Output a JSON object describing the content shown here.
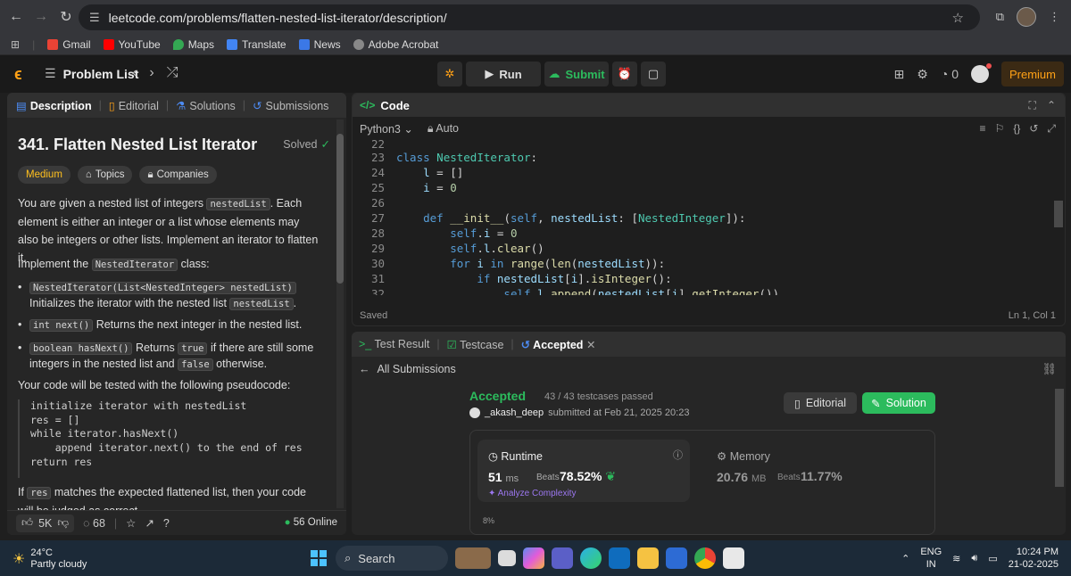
{
  "browser": {
    "url": "leetcode.com/problems/flatten-nested-list-iterator/description/",
    "bookmarks": [
      "Gmail",
      "YouTube",
      "Maps",
      "Translate",
      "News",
      "Adobe Acrobat"
    ]
  },
  "nav": {
    "problem_list": "Problem List",
    "run": "Run",
    "submit": "Submit",
    "streak_count": "0",
    "premium": "Premium"
  },
  "left": {
    "tabs": [
      "Description",
      "Editorial",
      "Solutions",
      "Submissions"
    ],
    "title": "341. Flatten Nested List Iterator",
    "solved": "Solved",
    "badges": [
      "Medium",
      "Topics",
      "Companies"
    ],
    "p1_a": "You are given a nested list of integers ",
    "p1_code": "nestedList",
    "p1_b": ". Each element is either an integer or a list whose elements may also be integers or other lists. Implement an iterator to flatten it.",
    "p2_a": "Implement the ",
    "p2_code": "NestedIterator",
    "p2_b": " class:",
    "b1_code": "NestedIterator(List<NestedInteger> nestedList)",
    "b1_a": " Initializes the iterator with the nested list ",
    "b1_code2": "nestedList",
    "b1_b": ".",
    "b2_code": "int next()",
    "b2_a": " Returns the next integer in the nested list.",
    "b3_code": "boolean hasNext()",
    "b3_a": " Returns ",
    "b3_code2": "true",
    "b3_b": " if there are still some integers in the nested list and ",
    "b3_code3": "false",
    "b3_c": " otherwise.",
    "p3": "Your code will be tested with the following pseudocode:",
    "pseudocode": "initialize iterator with nestedList\nres = []\nwhile iterator.hasNext()\n    append iterator.next() to the end of res\nreturn res",
    "p4_a": "If ",
    "p4_code": "res",
    "p4_b": " matches the expected flattened list, then your code will be judged as correct.",
    "likes": "5K",
    "comments": "68",
    "online": "56 Online"
  },
  "code": {
    "header": "Code",
    "language": "Python3",
    "mode": "Auto",
    "status": "Saved",
    "cursor": "Ln 1, Col 1",
    "line_numbers": [
      "22",
      "23",
      "24",
      "25",
      "26",
      "27",
      "28",
      "29",
      "30",
      "31",
      "32"
    ]
  },
  "result": {
    "tabs": [
      "Test Result",
      "Testcase",
      "Accepted"
    ],
    "all_submissions": "All Submissions",
    "status": "Accepted",
    "testcases": "43 / 43 testcases passed",
    "user": "_akash_deep",
    "submitted_text": "submitted at Feb 21, 2025 20:23",
    "editorial_btn": "Editorial",
    "solution_btn": "Solution",
    "runtime_label": "Runtime",
    "runtime_value": "51",
    "runtime_unit": "ms",
    "beats_label": "Beats",
    "runtime_beats": "78.52%",
    "analyze": "Analyze Complexity",
    "memory_label": "Memory",
    "memory_value": "20.76",
    "memory_unit": "MB",
    "memory_beats": "11.77%",
    "chart_tick": "8%"
  },
  "taskbar": {
    "temp": "24°C",
    "weather": "Partly cloudy",
    "search": "Search",
    "lang1": "ENG",
    "lang2": "IN",
    "time": "10:24 PM",
    "date": "21-02-2025"
  }
}
